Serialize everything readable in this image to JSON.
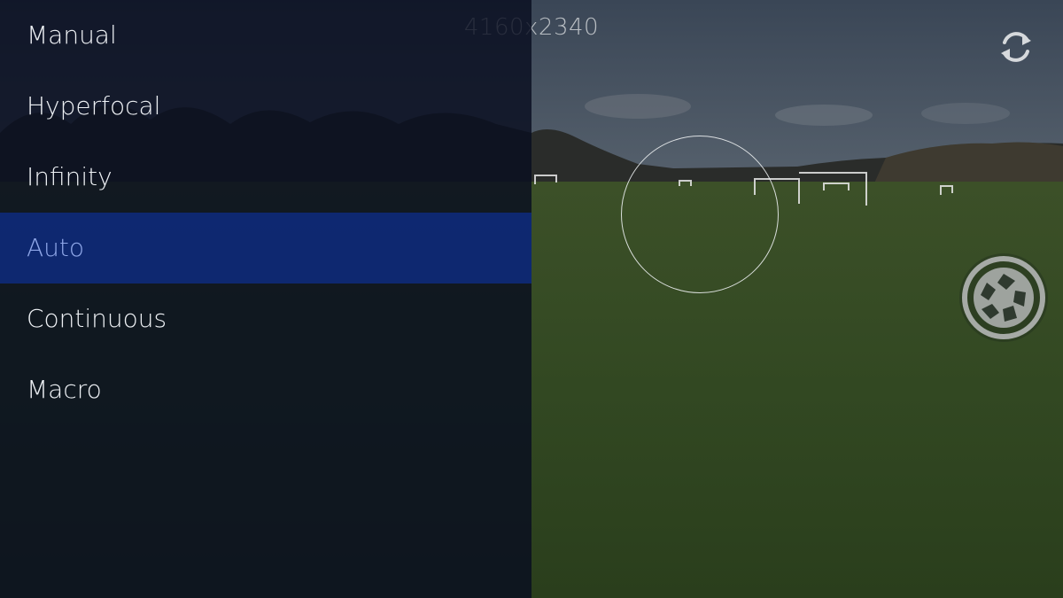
{
  "viewfinder": {
    "resolution_label": "4160x2340"
  },
  "focus_menu": {
    "items": [
      {
        "label": "Manual",
        "selected": false
      },
      {
        "label": "Hyperfocal",
        "selected": false
      },
      {
        "label": "Infinity",
        "selected": false
      },
      {
        "label": "Auto",
        "selected": true
      },
      {
        "label": "Continuous",
        "selected": false
      },
      {
        "label": "Macro",
        "selected": false
      }
    ],
    "selected_color": "#0e2c82",
    "panel_color": "#080e20"
  },
  "controls": {
    "switch_camera_icon": "camera-switch-icon",
    "shutter_icon": "shutter-aperture-icon"
  }
}
